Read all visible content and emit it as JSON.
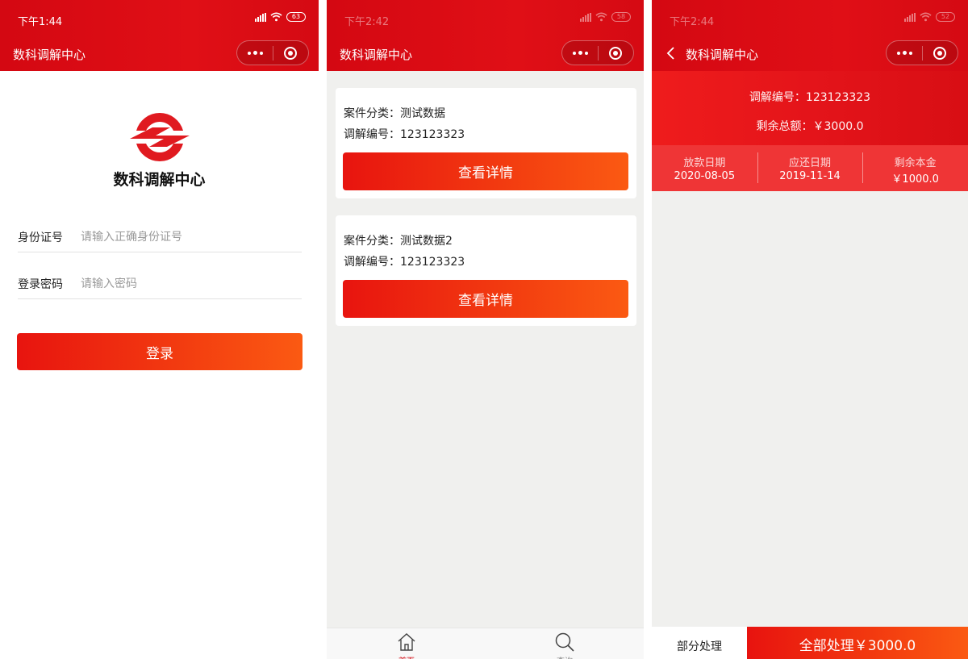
{
  "colors": {
    "header_red": "#d40812",
    "button_gradient_start": "#e8140f",
    "button_gradient_end": "#fb5a12",
    "tab_active": "#d40812"
  },
  "screen_login": {
    "status_time": "下午1:44",
    "battery": "63",
    "title": "数科调解中心",
    "logo_text": "数科调解中心",
    "id_label": "身份证号",
    "id_placeholder": "请输入正确身份证号",
    "password_label": "登录密码",
    "password_placeholder": "请输入密码",
    "login_button": "登录"
  },
  "screen_list": {
    "status_time": "下午2:42",
    "battery": "58",
    "title": "数科调解中心",
    "cards": [
      {
        "category": "案件分类：测试数据",
        "mediation_no": "调解编号：123123323",
        "button": "查看详情"
      },
      {
        "category": "案件分类：测试数据2",
        "mediation_no": "调解编号：123123323",
        "button": "查看详情"
      }
    ],
    "tabs": [
      {
        "label": "首页",
        "icon": "home-icon",
        "active": true
      },
      {
        "label": "查询",
        "icon": "search-icon",
        "active": false
      }
    ]
  },
  "screen_detail": {
    "status_time": "下午2:44",
    "battery": "52",
    "title": "数科调解中心",
    "mediation_no": "调解编号：123123323",
    "remaining_total": "剩余总额：￥3000.0",
    "columns": [
      {
        "label": "放款日期",
        "value": "2020-08-05"
      },
      {
        "label": "应还日期",
        "value": "2019-11-14"
      },
      {
        "label": "剩余本金",
        "value": "￥1000.0"
      }
    ],
    "partial_button": "部分处理",
    "all_button": "全部处理￥3000.0"
  }
}
